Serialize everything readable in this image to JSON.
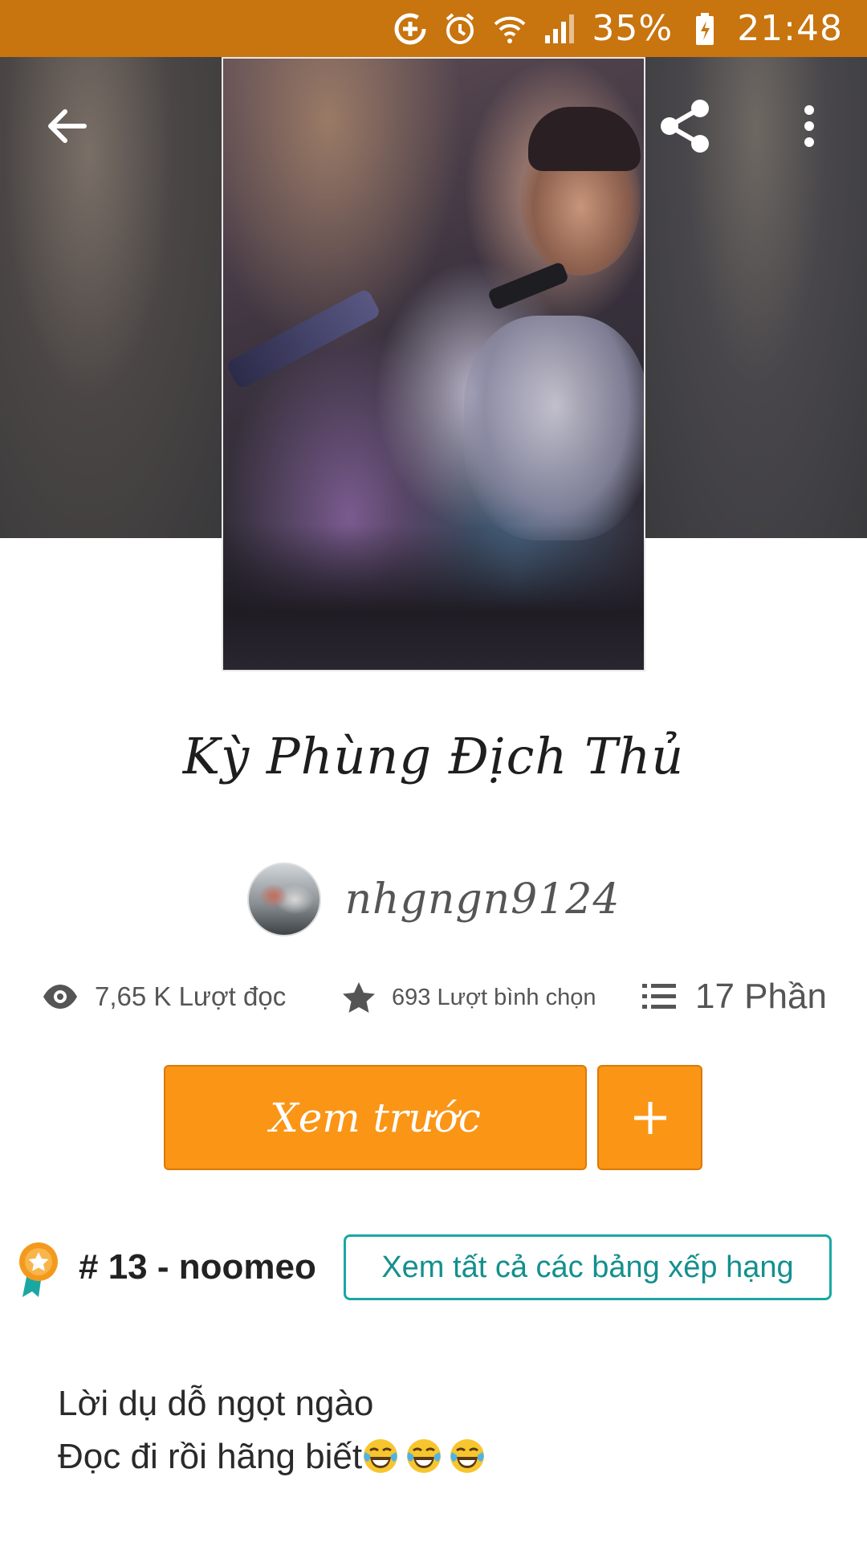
{
  "status_bar": {
    "battery": "35%",
    "time": "21:48",
    "icons": [
      "data-saver-icon",
      "alarm-icon",
      "wifi-icon",
      "signal-icon",
      "battery-charging-icon"
    ]
  },
  "toolbar": {
    "back_icon": "arrow-left-icon",
    "share_icon": "share-icon",
    "more_icon": "more-vertical-icon"
  },
  "story": {
    "title": "Kỳ Phùng Địch Thủ",
    "author": "nhgngn9124"
  },
  "stats": {
    "reads": "7,65 K Lượt đọc",
    "votes": "693 Lượt bình chọn",
    "parts": "17 Phần"
  },
  "actions": {
    "read_label": "Xem trước",
    "add_label": "+"
  },
  "ranking": {
    "text": "# 13 - noomeo",
    "all_rankings_label": "Xem tất cả các bảng xếp hạng"
  },
  "description": {
    "line1": "Lời dụ dỗ ngọt ngào",
    "line2": "Đọc đi rồi hãng biết"
  },
  "colors": {
    "status_bar": "#c8740f",
    "accent": "#fb9516",
    "teal": "#1aa7a4"
  }
}
